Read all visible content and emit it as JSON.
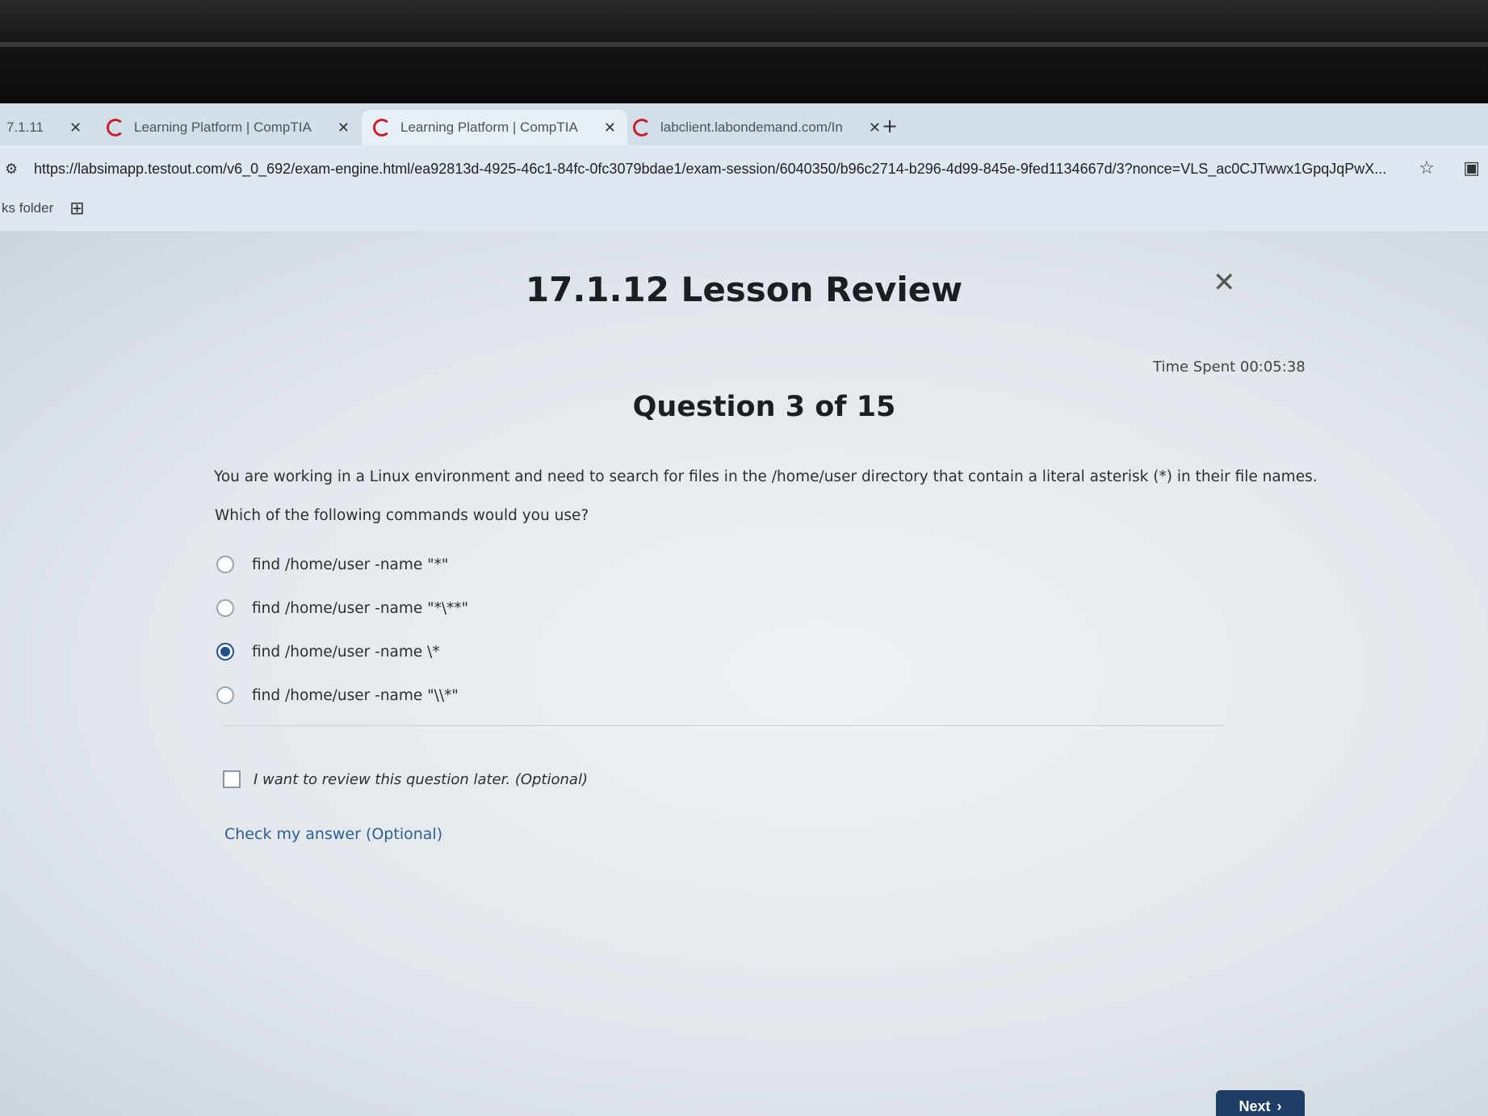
{
  "browser": {
    "tabs": [
      {
        "title": "7.1.11",
        "active": false
      },
      {
        "title": "Learning Platform | CompTIA",
        "active": false
      },
      {
        "title": "Learning Platform | CompTIA",
        "active": true
      },
      {
        "title": "labclient.labondemand.com/In",
        "active": false
      }
    ],
    "new_tab_symbol": "+",
    "close_symbol": "✕",
    "url": "https://labsimapp.testout.com/v6_0_692/exam-engine.html/ea92813d-4925-46c1-84fc-0fc3079bdae1/exam-session/6040350/b96c2714-b296-4d99-845e-9fed1134667d/3?nonce=VLS_ac0CJTwwx1GpqJqPwX...",
    "bookmark_label": "ks folder"
  },
  "lesson": {
    "title": "17.1.12 Lesson Review",
    "close_symbol": "✕",
    "time_spent": "Time Spent 00:05:38"
  },
  "question": {
    "heading": "Question 3 of 15",
    "text": "You are working in a Linux environment and need to search for files in the /home/user directory that contain a literal asterisk (*) in their file names.",
    "prompt": "Which of the following commands would you use?",
    "options": [
      {
        "label": "find /home/user -name \"*\"",
        "selected": false
      },
      {
        "label": "find /home/user -name \"*\\**\"",
        "selected": false
      },
      {
        "label": "find /home/user -name \\*",
        "selected": true
      },
      {
        "label": "find /home/user -name \"\\\\*\"",
        "selected": false
      }
    ]
  },
  "review": {
    "label": "I want to review this question later. (Optional)",
    "checked": false
  },
  "check_answer_label": "Check my answer (Optional)",
  "next_button": {
    "label": "Next",
    "chevron": "›"
  },
  "colors": {
    "accent": "#1d3f66",
    "link": "#2f5f8f",
    "radio_selected": "#1f4e8c"
  }
}
